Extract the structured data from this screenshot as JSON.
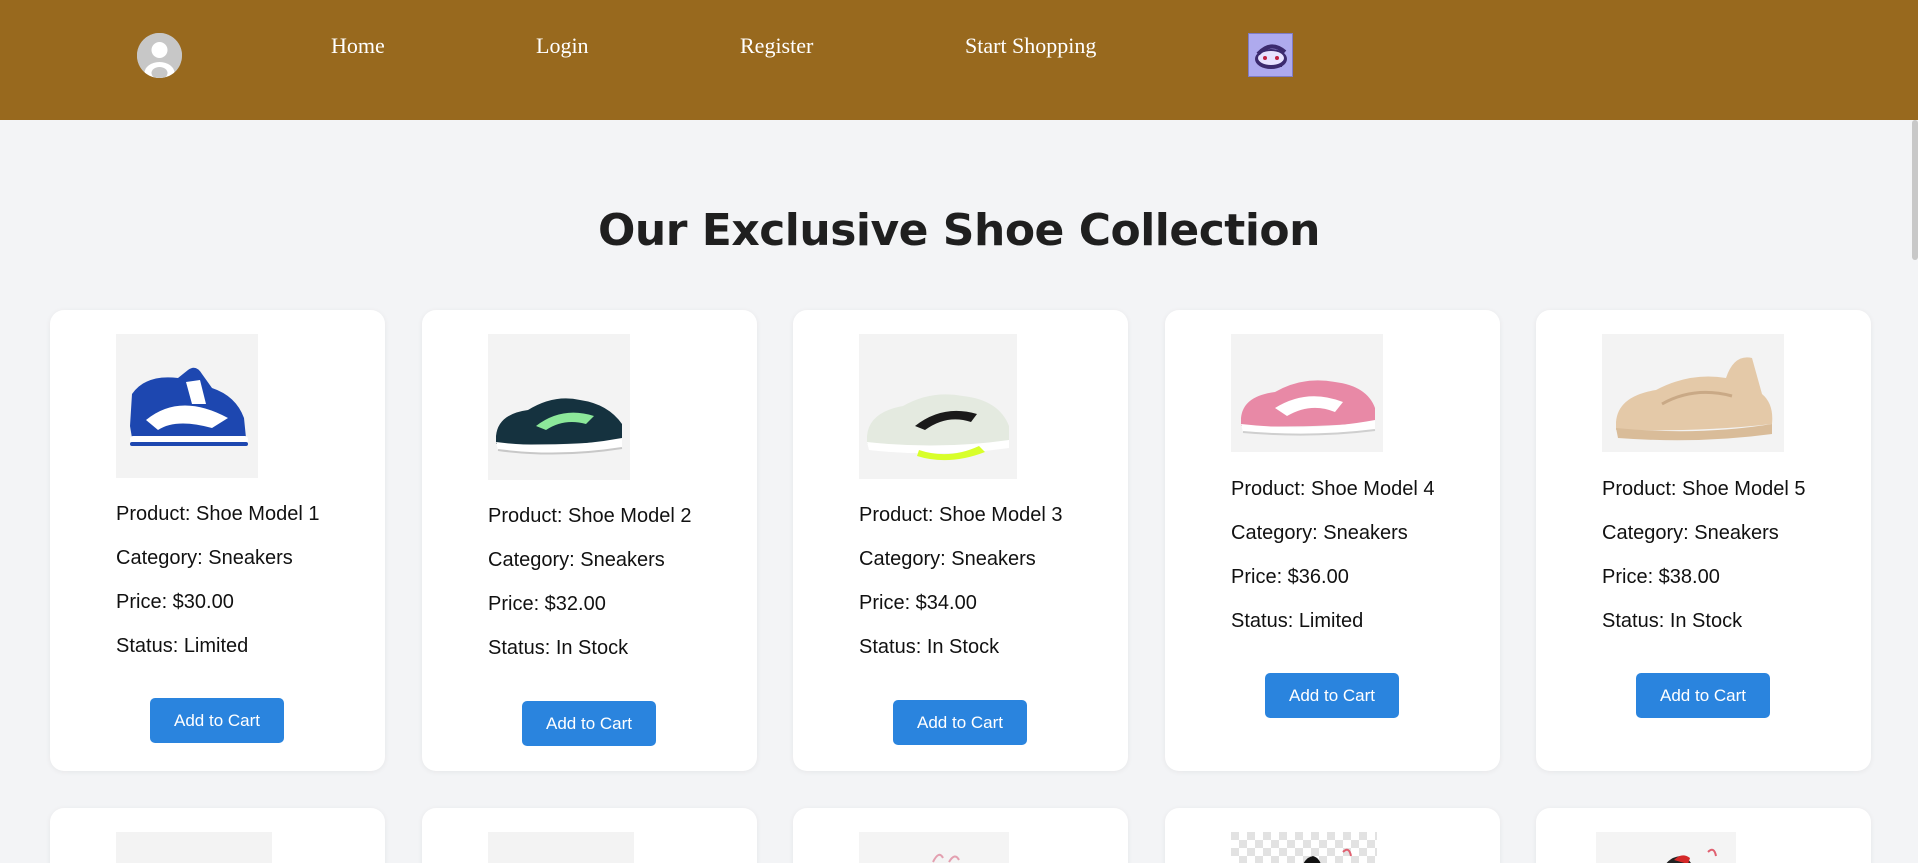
{
  "nav": {
    "avatar_icon": "user-avatar-icon",
    "links": [
      "Home",
      "Login",
      "Register",
      "Start Shopping"
    ],
    "logo_icon": "brand-logo-icon"
  },
  "main": {
    "title": "Our Exclusive Shoe Collection"
  },
  "products": [
    {
      "product": "Product: Shoe Model 1",
      "category": "Category: Sneakers",
      "price": "Price: $30.00",
      "status": "Status: Limited",
      "button": "Add to Cart",
      "image": "blue-white-high-top-sneaker"
    },
    {
      "product": "Product: Shoe Model 2",
      "category": "Category: Sneakers",
      "price": "Price: $32.00",
      "status": "Status: In Stock",
      "button": "Add to Cart",
      "image": "navy-green-running-shoe"
    },
    {
      "product": "Product: Shoe Model 3",
      "category": "Category: Sneakers",
      "price": "Price: $34.00",
      "status": "Status: In Stock",
      "button": "Add to Cart",
      "image": "white-volt-running-shoe"
    },
    {
      "product": "Product: Shoe Model 4",
      "category": "Category: Sneakers",
      "price": "Price: $36.00",
      "status": "Status: Limited",
      "button": "Add to Cart",
      "image": "pink-white-low-top-sneaker"
    },
    {
      "product": "Product: Shoe Model 5",
      "category": "Category: Sneakers",
      "price": "Price: $38.00",
      "status": "Status: In Stock",
      "button": "Add to Cart",
      "image": "beige-chunky-sneaker"
    }
  ],
  "colors": {
    "navbar": "#98691e",
    "page_background": "#f3f4f6",
    "button": "#2a84de",
    "title_text": "#1f1f1f"
  }
}
